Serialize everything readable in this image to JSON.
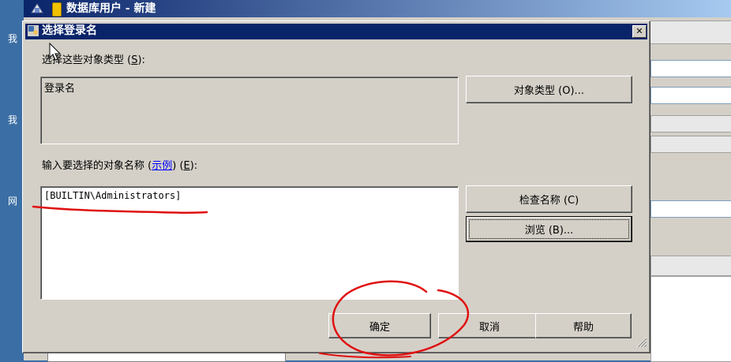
{
  "parent_window": {
    "title": "数据库用户 - 新建",
    "side_labels": [
      "我",
      "我",
      "网"
    ]
  },
  "dialog": {
    "title": "选择登录名",
    "close_glyph": "✕",
    "object_types_label_prefix": "选择这些对象类型 (",
    "object_types_label_key": "S",
    "object_types_label_suffix": "):",
    "object_types_value": "登录名",
    "object_types_button": "对象类型 (O)...",
    "names_label_prefix": "输入要选择的对象名称 (",
    "names_label_link": "示例",
    "names_label_mid": ") (",
    "names_label_key": "E",
    "names_label_suffix": "):",
    "names_value": "[BUILTIN\\Administrators]",
    "check_names_button": "检查名称 (C)",
    "browse_button": "浏览 (B)...",
    "ok_button": "确定",
    "cancel_button": "取消",
    "help_button": "帮助"
  },
  "colors": {
    "titlebar": "#0a246a",
    "dialog_bg": "#d4d0c8",
    "desktop": "#3a6ea5",
    "annotation": "#e01010"
  }
}
